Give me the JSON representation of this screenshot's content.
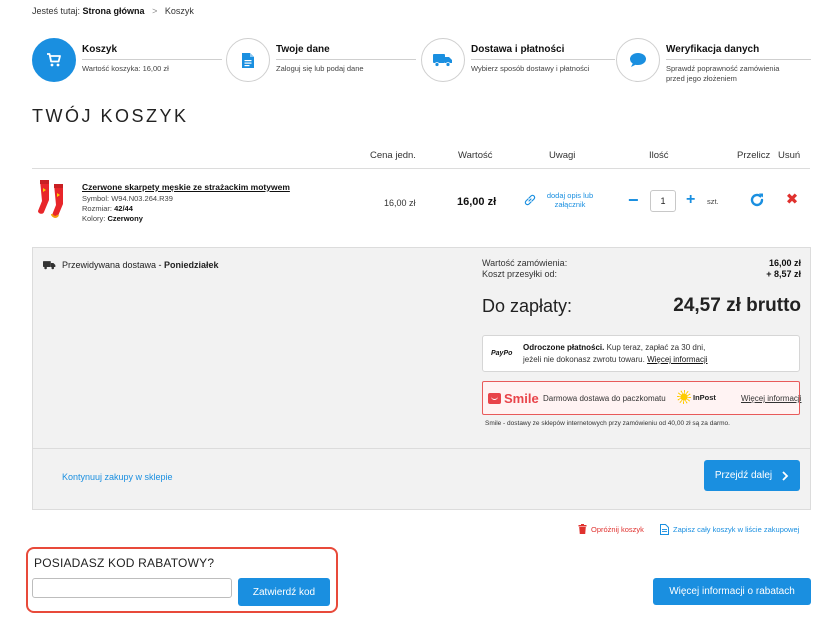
{
  "breadcrumb": {
    "prefix": "Jesteś tutaj:",
    "home": "Strona główna",
    "separator": ">",
    "current": "Koszyk"
  },
  "steps": [
    {
      "title": "Koszyk",
      "sub": "Wartość koszyka: 16,00 zł",
      "sub2": "",
      "icon": "cart-icon",
      "active": true
    },
    {
      "title": "Twoje dane",
      "sub": "Zaloguj się lub podaj dane",
      "sub2": "",
      "icon": "document-icon",
      "active": false
    },
    {
      "title": "Dostawa i płatności",
      "sub": "Wybierz sposób dostawy i płatności",
      "sub2": "",
      "icon": "truck-icon",
      "active": false
    },
    {
      "title": "Weryfikacja danych",
      "sub": "Sprawdź poprawność zamówienia",
      "sub2": "przed jego złożeniem",
      "icon": "chat-icon",
      "active": false
    }
  ],
  "page_title": "TWÓJ KOSZYK",
  "table": {
    "headers": {
      "unit_price": "Cena jedn.",
      "value": "Wartość",
      "remarks": "Uwagi",
      "quantity": "Ilość",
      "recalculate": "Przelicz",
      "remove": "Usuń"
    }
  },
  "product": {
    "name": "Czerwone skarpety męskie ze strażackim motywem",
    "symbol_label": "Symbol:",
    "symbol": "W94.N03.264.R39",
    "size_label": "Rozmiar:",
    "size": "42/44",
    "color_label": "Kolory:",
    "color": "Czerwony",
    "unit_price": "16,00 zł",
    "value": "16,00 zł",
    "remark_link_line1": "dodaj opis lub",
    "remark_link_line2": "załącznik",
    "quantity": "1",
    "qty_unit": "szt."
  },
  "summary": {
    "delivery_prefix": "Przewidywana dostawa - ",
    "delivery_day": "Poniedziałek",
    "order_value_label": "Wartość zamówienia:",
    "order_value": "16,00 zł",
    "shipping_label": "Koszt przesyłki od:",
    "shipping_value": "+ 8,57 zł",
    "total_label": "Do zapłaty:",
    "total_value": "24,57 zł brutto"
  },
  "paypo": {
    "logo": "PayPo",
    "bold": "Odroczone płatności.",
    "line1": " Kup teraz, zapłać za 30 dni,",
    "line2": "jeżeli nie dokonasz zwrotu towaru. ",
    "more": "Więcej informacji"
  },
  "smile": {
    "logo": "Smile",
    "text": "Darmowa dostawa do paczkomatu",
    "inpost": "InPost",
    "more": "Więcej informacji",
    "note": "Smile - dostawy ze sklepów internetowych przy zamówieniu od 40,00 zł są za darmo."
  },
  "actions": {
    "continue": "Kontynuuj zakupy w sklepie",
    "next": "Przejdź dalej",
    "empty_cart": "Opróżnij koszyk",
    "save_list": "Zapisz cały koszyk w liście zakupowej"
  },
  "discount": {
    "title": "POSIADASZ KOD RABATOWY?",
    "input_value": "",
    "submit": "Zatwierdź kod",
    "more_info": "Więcej informacji o rabatach"
  },
  "colors": {
    "accent": "#1a8fe0",
    "danger": "#e0312e",
    "panel": "#f2f2f2",
    "discount_border": "#e84a3a"
  }
}
